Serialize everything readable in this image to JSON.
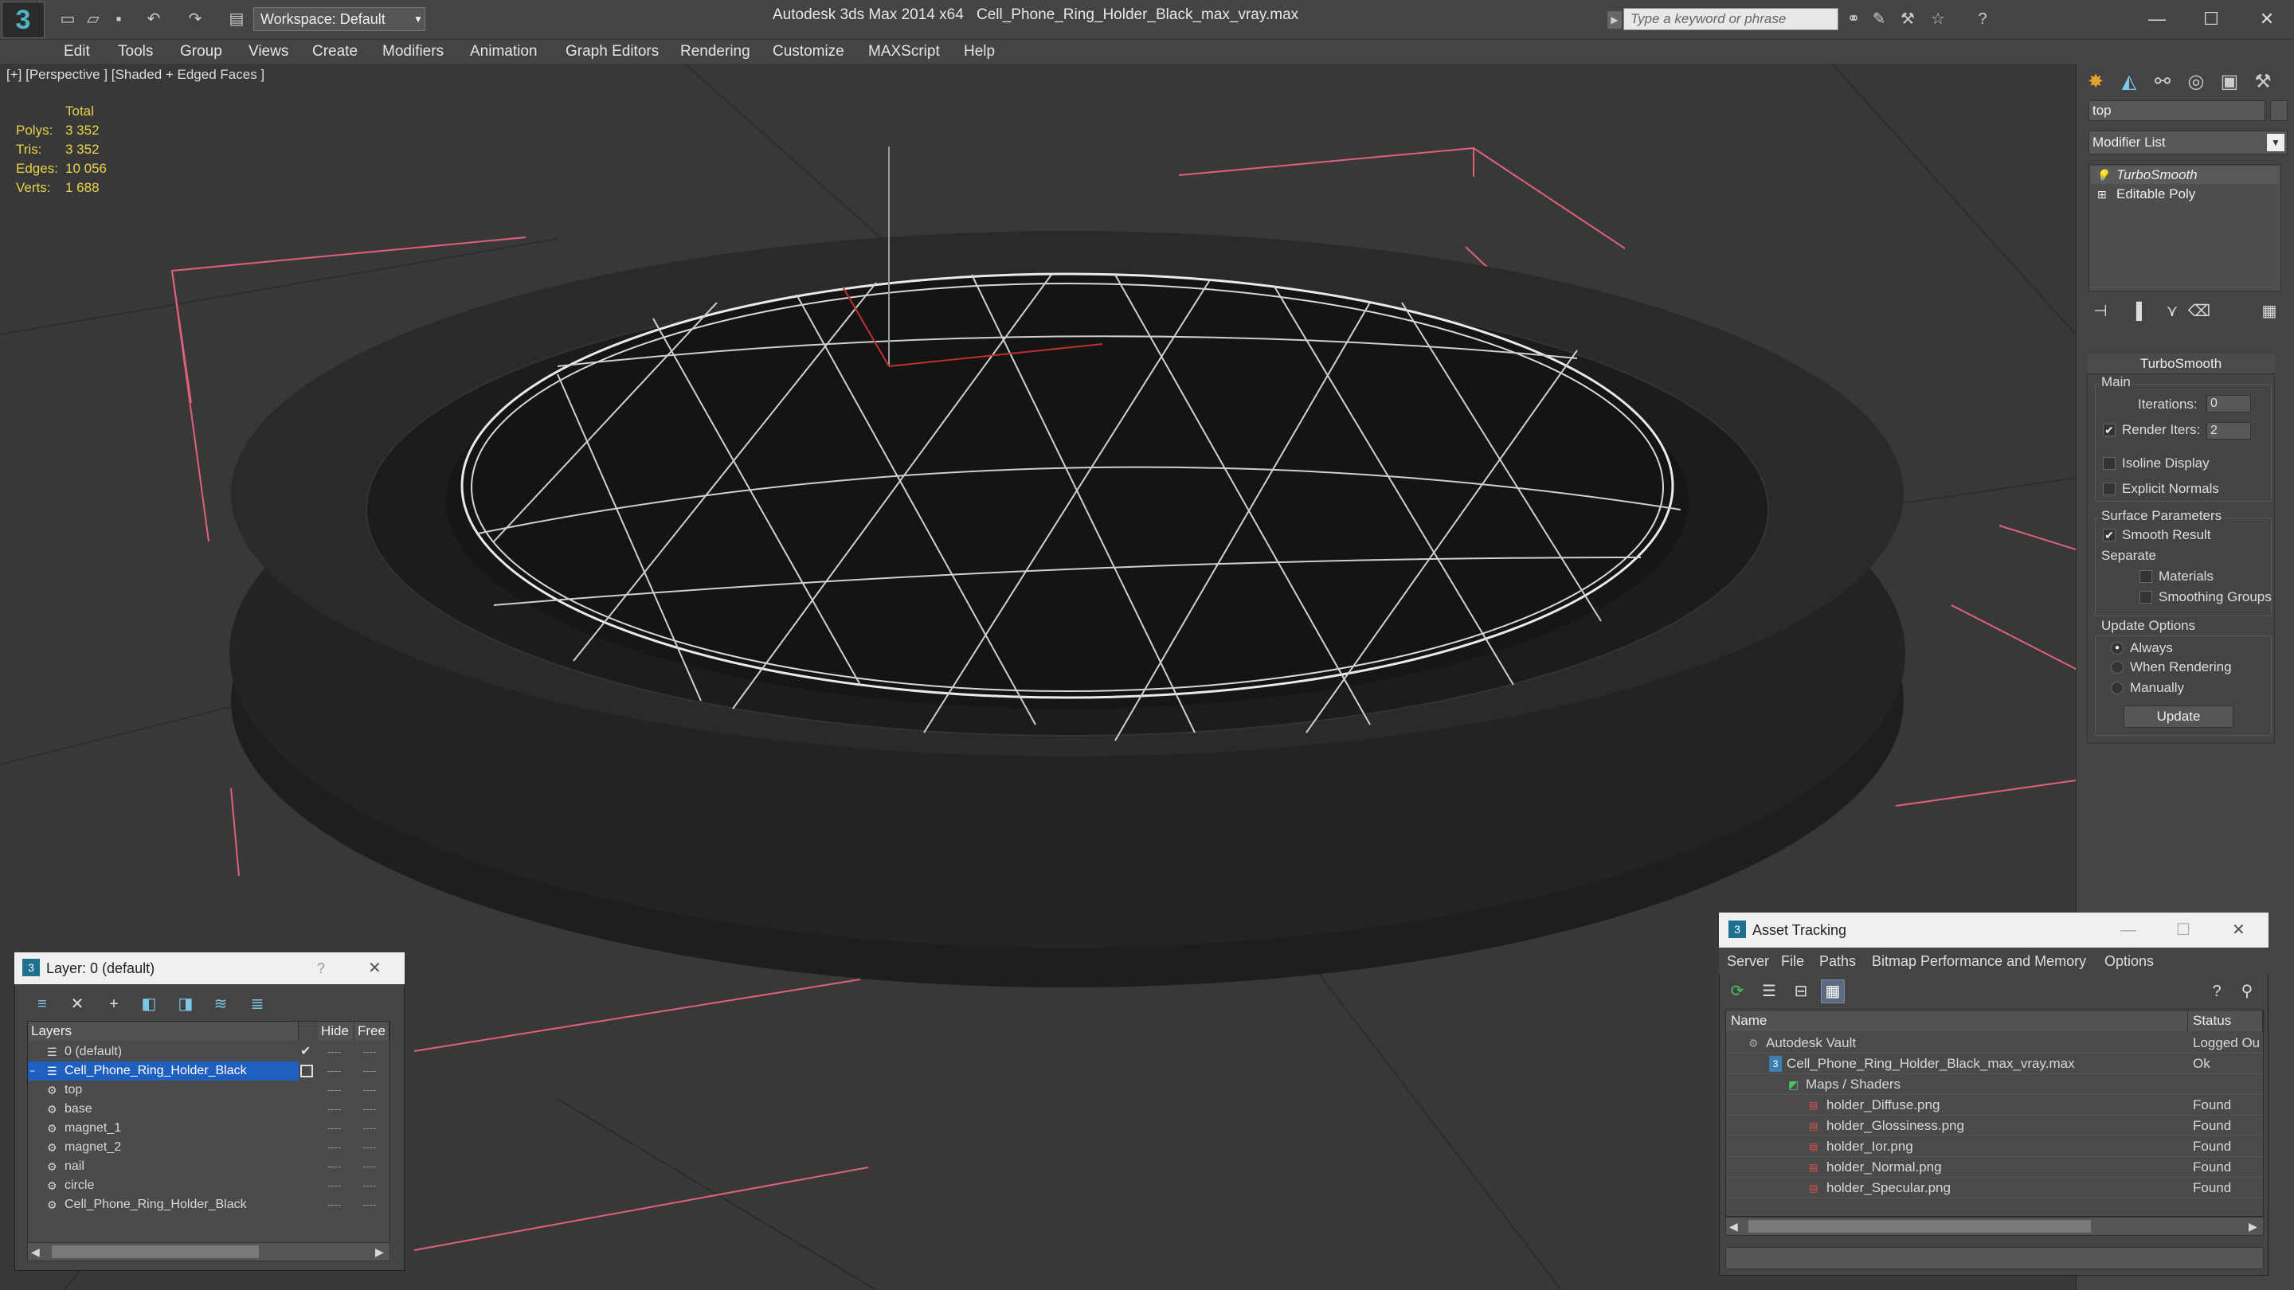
{
  "app": {
    "title": "Autodesk 3ds Max  2014 x64",
    "file": "Cell_Phone_Ring_Holder_Black_max_vray.max",
    "workspace": "Workspace: Default",
    "search_placeholder": "Type a keyword or phrase"
  },
  "menu": [
    "Edit",
    "Tools",
    "Group",
    "Views",
    "Create",
    "Modifiers",
    "Animation",
    "Graph Editors",
    "Rendering",
    "Customize",
    "MAXScript",
    "Help"
  ],
  "viewport": {
    "label": "[+] [Perspective ] [Shaded + Edged Faces ]",
    "stats": {
      "header": "Total",
      "rows": [
        {
          "k": "Polys:",
          "v": "3 352"
        },
        {
          "k": "Tris:",
          "v": "3 352"
        },
        {
          "k": "Edges:",
          "v": "10 056"
        },
        {
          "k": "Verts:",
          "v": "1 688"
        }
      ]
    }
  },
  "command_panel": {
    "object_name": "top",
    "modifier_list": "Modifier List",
    "stack": [
      "TurboSmooth",
      "Editable Poly"
    ],
    "rollout": {
      "title": "TurboSmooth",
      "main": "Main",
      "iterations_label": "Iterations:",
      "iterations": "0",
      "render_iters_label": "Render Iters:",
      "render_iters": "2",
      "isoline": "Isoline Display",
      "explicit_normals": "Explicit Normals",
      "surface_params": "Surface Parameters",
      "smooth_result": "Smooth Result",
      "separate": "Separate",
      "materials": "Materials",
      "smoothing_groups": "Smoothing Groups",
      "update_options": "Update Options",
      "always": "Always",
      "when_rendering": "When Rendering",
      "manually": "Manually",
      "update_btn": "Update"
    }
  },
  "layer_window": {
    "title": "Layer: 0 (default)",
    "help": "?",
    "columns": [
      "Layers",
      "Hide",
      "Free"
    ],
    "rows": [
      {
        "name": "0 (default)",
        "level": 0
      },
      {
        "name": "Cell_Phone_Ring_Holder_Black",
        "level": 0
      },
      {
        "name": "top",
        "level": 1
      },
      {
        "name": "base",
        "level": 1
      },
      {
        "name": "magnet_1",
        "level": 1
      },
      {
        "name": "magnet_2",
        "level": 1
      },
      {
        "name": "nail",
        "level": 1
      },
      {
        "name": "circle",
        "level": 1
      },
      {
        "name": "Cell_Phone_Ring_Holder_Black",
        "level": 1
      }
    ]
  },
  "asset_tracking": {
    "title": "Asset Tracking",
    "menu": [
      "Server",
      "File",
      "Paths",
      "Bitmap Performance and Memory",
      "Options"
    ],
    "columns": [
      "Name",
      "Status"
    ],
    "rows": [
      {
        "name": "Autodesk Vault",
        "status": "Logged Ou",
        "level": 0
      },
      {
        "name": "Cell_Phone_Ring_Holder_Black_max_vray.max",
        "status": "Ok",
        "level": 1
      },
      {
        "name": "Maps / Shaders",
        "status": "",
        "level": 2
      },
      {
        "name": "holder_Diffuse.png",
        "status": "Found",
        "level": 3
      },
      {
        "name": "holder_Glossiness.png",
        "status": "Found",
        "level": 3
      },
      {
        "name": "holder_Ior.png",
        "status": "Found",
        "level": 3
      },
      {
        "name": "holder_Normal.png",
        "status": "Found",
        "level": 3
      },
      {
        "name": "holder_Specular.png",
        "status": "Found",
        "level": 3
      }
    ]
  },
  "colors": {
    "selection": "#1f5fbf",
    "accent": "#e6a030",
    "stats": "#e8d44a"
  }
}
